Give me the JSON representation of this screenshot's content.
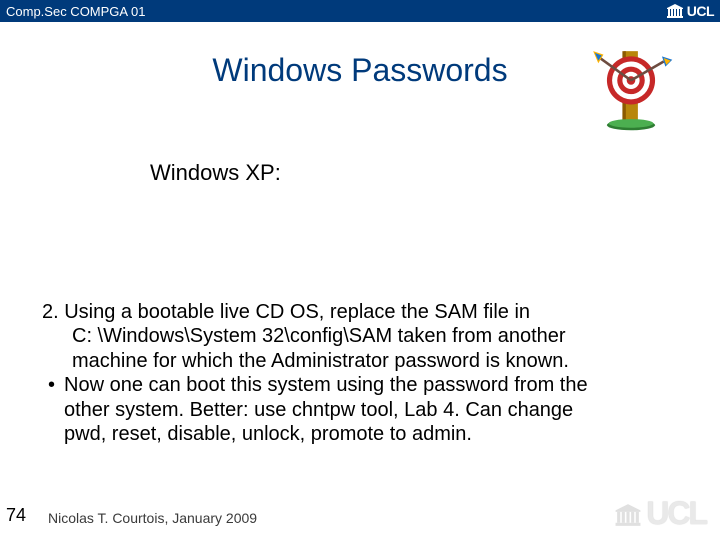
{
  "topbar": {
    "course": "Comp.Sec COMPGA 01",
    "university_abbrev": "UCL"
  },
  "title": "Windows Passwords",
  "subtitle": "Windows XP:",
  "body": {
    "line1": "2. Using a bootable live CD OS, replace the SAM file in",
    "line2": "C: \\Windows\\System 32\\config\\SAM taken from another",
    "line3": "machine for which the Administrator password is known.",
    "bullet1a": "Now one can boot this system using the password from the",
    "bullet1b": "other system.  Better: use chntpw tool, Lab 4. Can change",
    "bullet1c": "pwd, reset, disable, unlock, promote to admin."
  },
  "slide_number": "74",
  "footer": "Nicolas T. Courtois, January 2009",
  "logo_text": "UCL",
  "icons": {
    "target": "target-dartboard-icon",
    "portico": "ucl-portico-icon"
  }
}
